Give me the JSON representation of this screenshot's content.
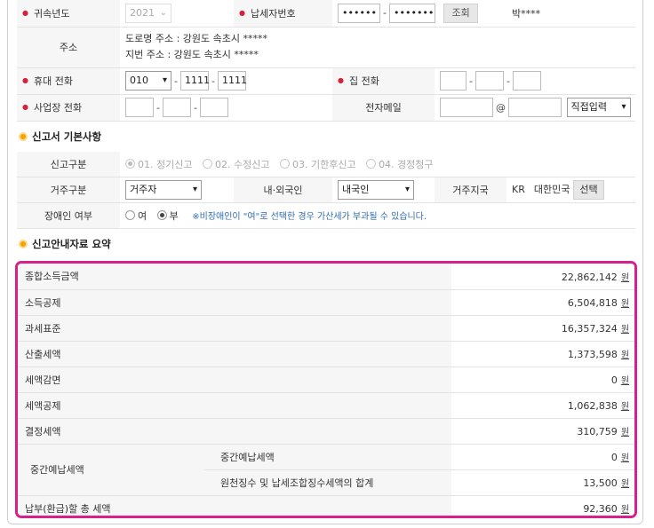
{
  "taxpayer": {
    "year_label": "귀속년도",
    "year_value": "2021",
    "taxid_label": "납세자번호",
    "taxid_part1": "••••••",
    "taxid_part2": "•••••••",
    "lookup_button": "조회",
    "name_masked": "박****",
    "address_label": "주소",
    "road_address": "도로명 주소 :  강원도 속초시 *****",
    "lot_address": "지번 주소 :  강원도 속초시 *****",
    "mobile_label": "휴대 전화",
    "mobile_prefix": "010",
    "mobile_mid": "1111",
    "mobile_last": "1111",
    "home_label": "집 전화",
    "work_label": "사업장 전화",
    "email_label": "전자메일",
    "email_at": "@",
    "email_domain_select": "직접입력"
  },
  "basic": {
    "section_title": "신고서 기본사항",
    "report_type_label": "신고구분",
    "report_types": [
      "01. 정기신고",
      "02. 수정신고",
      "03. 기한후신고",
      "04. 경정청구"
    ],
    "residence_label": "거주구분",
    "residence_value": "거주자",
    "nationality_label": "내·외국인",
    "nationality_value": "내국인",
    "region_label": "거주지국",
    "region_code": "KR",
    "region_name": "대한민국",
    "region_button": "선택",
    "disabled_label": "장애인 여부",
    "disabled_yes": "여",
    "disabled_no": "부",
    "disabled_note": "※비장애인이 \"여\"로 선택한 경우 가산세가 부과될 수 있습니다."
  },
  "summary": {
    "section_title": "신고안내자료 요약",
    "currency_unit": "원",
    "rows": [
      {
        "label": "종합소득금액",
        "value": "22,862,142"
      },
      {
        "label": "소득공제",
        "value": "6,504,818"
      },
      {
        "label": "과세표준",
        "value": "16,357,324"
      },
      {
        "label": "산출세액",
        "value": "1,373,598"
      },
      {
        "label": "세액감면",
        "value": "0"
      },
      {
        "label": "세액공제",
        "value": "1,062,838"
      },
      {
        "label": "결정세액",
        "value": "310,759"
      }
    ],
    "interim_label": "중간예납세액",
    "interim_sub": [
      {
        "label": "중간예납세액",
        "value": "0"
      },
      {
        "label": "원천징수 및 납세조합징수세액의 합계",
        "value": "13,500"
      }
    ],
    "final_label": "납부(환급)할 총 세액",
    "final_value": "92,360"
  },
  "colors": {
    "highlight": "#d7208b",
    "required": "#d4233a",
    "bullet": "#f0a500",
    "note": "#2f6db3"
  }
}
